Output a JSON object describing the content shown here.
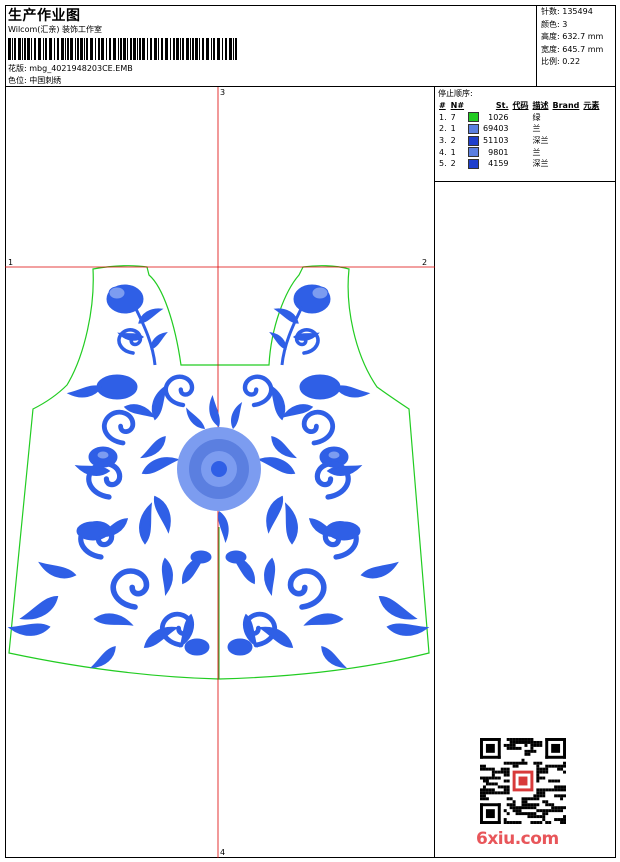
{
  "header": {
    "title": "生产作业图",
    "company": "Wilcom(汇亲) 装饰工作室",
    "design_label": "花版:",
    "design_name": "mbg_4021948203CE.EMB",
    "color_label": "色位:",
    "color_value": "中国刺绣"
  },
  "stats": {
    "stitches_label": "针数:",
    "stitches": "135494",
    "colors_label": "颜色:",
    "colors": "3",
    "height_label": "高度:",
    "height": "632.7 mm",
    "width_label": "宽度:",
    "width": "645.7 mm",
    "scale_label": "比例:",
    "scale": "0.22"
  },
  "stop_sequence": {
    "title": "停止顺序:",
    "columns": [
      "#",
      "N#",
      "St.",
      "代码",
      "描述",
      "Brand",
      "元素"
    ],
    "rows": [
      {
        "idx": "1.",
        "needle": "7",
        "stitches": "1026",
        "desc": "绿",
        "color": "#22cc22"
      },
      {
        "idx": "2.",
        "needle": "1",
        "stitches": "69403",
        "desc": "兰",
        "color": "#5b7fe0"
      },
      {
        "idx": "3.",
        "needle": "2",
        "stitches": "51103",
        "desc": "深兰",
        "color": "#1f3fcc"
      },
      {
        "idx": "4.",
        "needle": "1",
        "stitches": "9801",
        "desc": "兰",
        "color": "#5b7fe0"
      },
      {
        "idx": "5.",
        "needle": "2",
        "stitches": "4159",
        "desc": "深兰",
        "color": "#1f3fcc"
      }
    ]
  },
  "axes": {
    "h_start": "1",
    "h_end": "2",
    "v_start": "3",
    "v_end": "4"
  },
  "watermark": {
    "text": "6xiu.com"
  },
  "colors": {
    "outline": "#22cc22",
    "embroidery": "#2f5fe6",
    "light_embroidery": "#7c9cf0",
    "guide": "#dd0000"
  }
}
